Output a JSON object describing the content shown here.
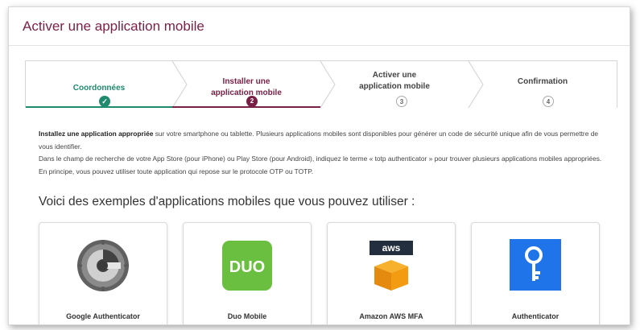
{
  "page": {
    "title": "Activer une application mobile"
  },
  "stepper": {
    "steps": [
      {
        "label": "Coordonnées",
        "marker": "✓",
        "state": "done"
      },
      {
        "label": "Installer une application mobile",
        "marker": "2",
        "state": "current"
      },
      {
        "label": "Activer une application mobile",
        "marker": "3",
        "state": "todo"
      },
      {
        "label": "Confirmation",
        "marker": "4",
        "state": "todo"
      }
    ],
    "colors": {
      "done": "#1f8a6e",
      "current": "#7a1f45",
      "todo": "#9a9a9a"
    }
  },
  "intro": {
    "p1_bold": "Installez une application appropriée",
    "p1_rest": " sur votre smartphone ou tablette. Plusieurs applications mobiles sont disponibles pour générer un code de sécurité unique afin de vous permettre de vous identifier.",
    "p2": "Dans le champ de recherche de votre App Store (pour iPhone) ou Play Store (pour Android), indiquez le terme « totp authenticator » pour trouver plusieurs applications mobiles appropriées. En principe, vous pouvez utiliser toute application qui repose sur le protocole OTP ou TOTP."
  },
  "examples": {
    "heading": "Voici des exemples d'applications mobiles que vous pouvez utiliser :",
    "apps": [
      {
        "name": "Google Authenticator",
        "icon": "google-authenticator-icon"
      },
      {
        "name": "Duo Mobile",
        "icon": "duo-mobile-icon",
        "logo_text": "DUO"
      },
      {
        "name": "Amazon AWS MFA",
        "icon": "aws-icon",
        "logo_text": "aws"
      },
      {
        "name": "Authenticator",
        "icon": "key-icon"
      }
    ]
  }
}
